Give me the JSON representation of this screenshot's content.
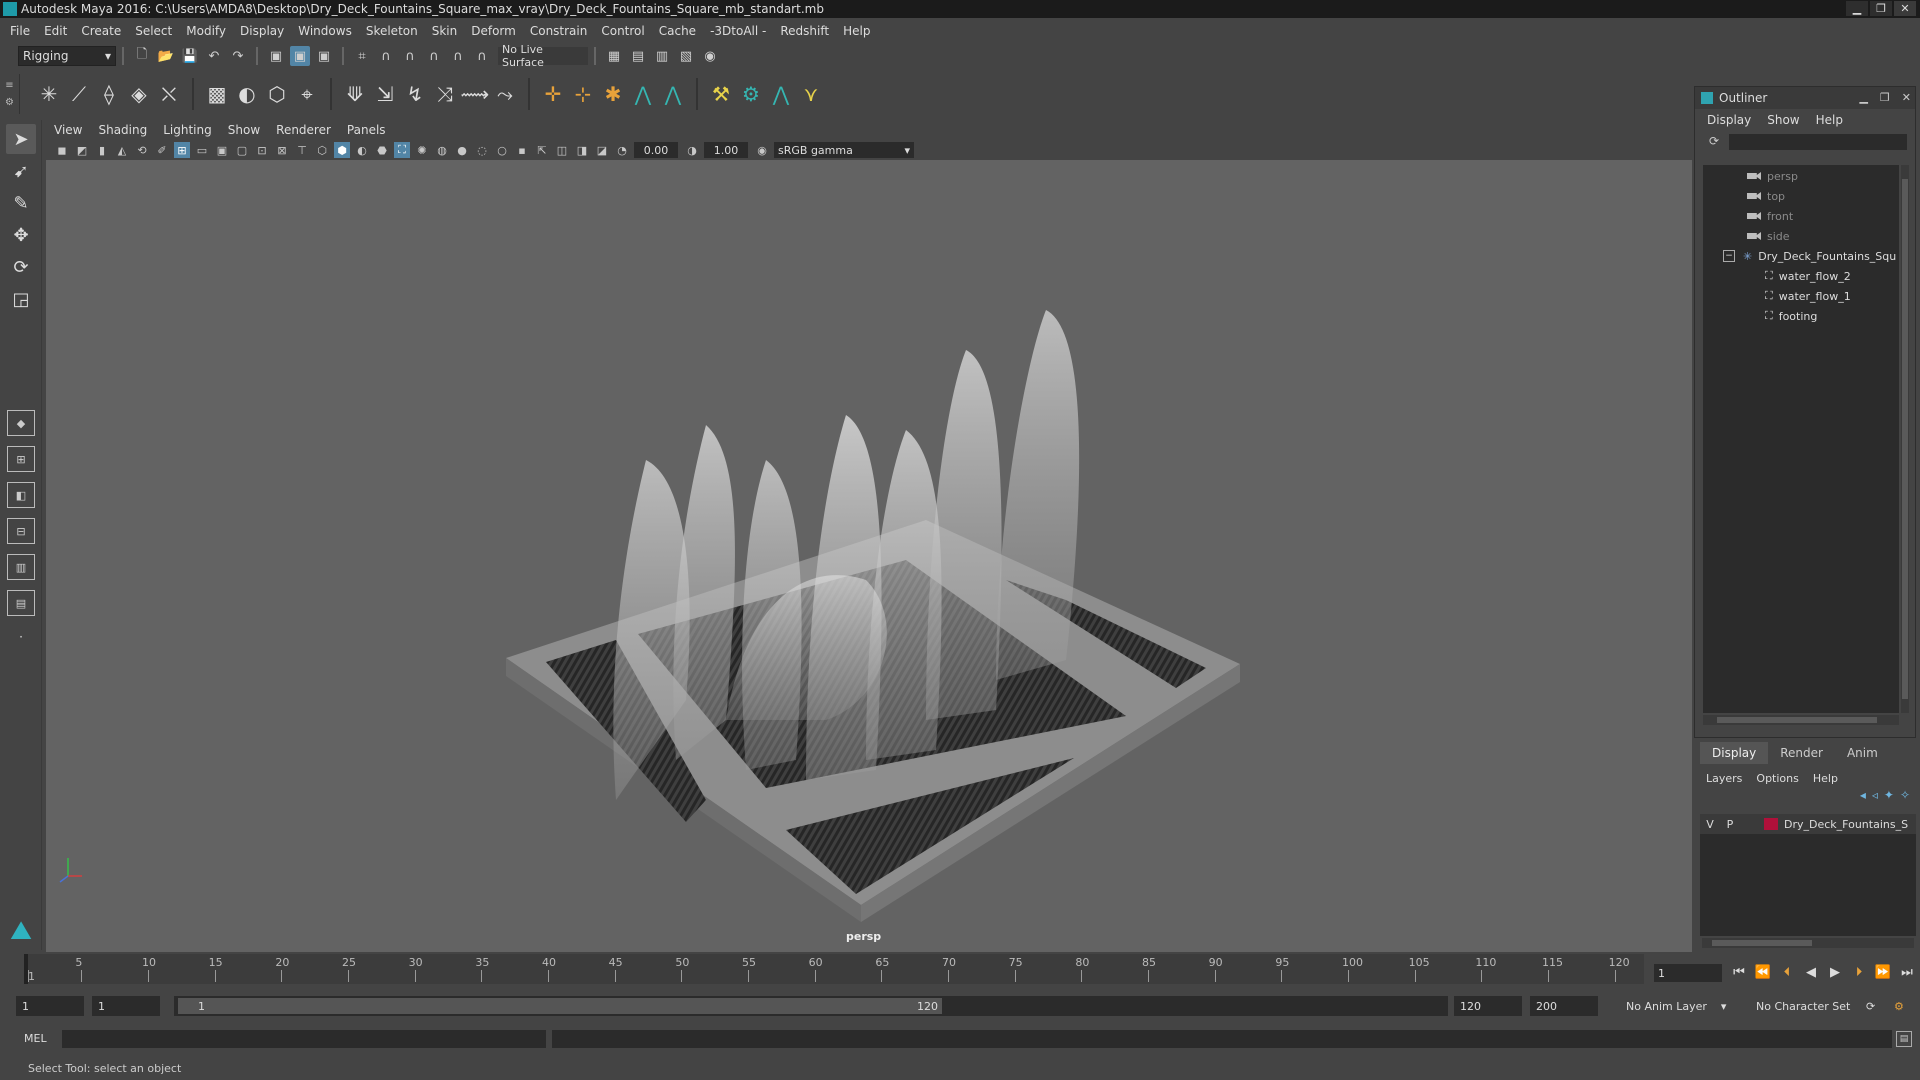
{
  "window": {
    "title": "Autodesk Maya 2016: C:\\Users\\AMDA8\\Desktop\\Dry_Deck_Fountains_Square_max_vray\\Dry_Deck_Fountains_Square_mb_standart.mb"
  },
  "menus": [
    "File",
    "Edit",
    "Create",
    "Select",
    "Modify",
    "Display",
    "Windows",
    "Skeleton",
    "Skin",
    "Deform",
    "Constrain",
    "Control",
    "Cache",
    "-3DtoAll -",
    "Redshift",
    "Help"
  ],
  "statusline": {
    "mode": "Rigging",
    "live_surface": "No Live Surface"
  },
  "panel": {
    "menus": [
      "View",
      "Shading",
      "Lighting",
      "Show",
      "Renderer",
      "Panels"
    ],
    "exposure": "0.00",
    "gamma": "1.00",
    "color_space": "sRGB gamma",
    "camera": "persp"
  },
  "outliner": {
    "title": "Outliner",
    "menus": [
      "Display",
      "Show",
      "Help"
    ],
    "items": [
      {
        "label": "persp"
      },
      {
        "label": "top"
      },
      {
        "label": "front"
      },
      {
        "label": "side"
      },
      {
        "label": "Dry_Deck_Fountains_Squ"
      },
      {
        "label": "water_flow_2"
      },
      {
        "label": "water_flow_1"
      },
      {
        "label": "footing"
      }
    ]
  },
  "layers": {
    "tabs": [
      "Display",
      "Render",
      "Anim"
    ],
    "menus": [
      "Layers",
      "Options",
      "Help"
    ],
    "row": {
      "v": "V",
      "p": "P",
      "name": "Dry_Deck_Fountains_S",
      "color": "#b0103a"
    }
  },
  "timeline": {
    "ticks": [
      "1",
      "5",
      "10",
      "15",
      "20",
      "25",
      "30",
      "35",
      "40",
      "45",
      "50",
      "55",
      "60",
      "65",
      "70",
      "75",
      "80",
      "85",
      "90",
      "95",
      "100",
      "105",
      "110",
      "115",
      "120"
    ],
    "current_frame": "1"
  },
  "range": {
    "start": "1",
    "playback_start": "1",
    "thumb_start": "1",
    "thumb_end": "120",
    "playback_end": "120",
    "end": "200",
    "anim_layer": "No Anim Layer",
    "character_set": "No Character Set"
  },
  "cmdline": {
    "label": "MEL"
  },
  "helpline": {
    "text": "Select Tool: select an object"
  }
}
